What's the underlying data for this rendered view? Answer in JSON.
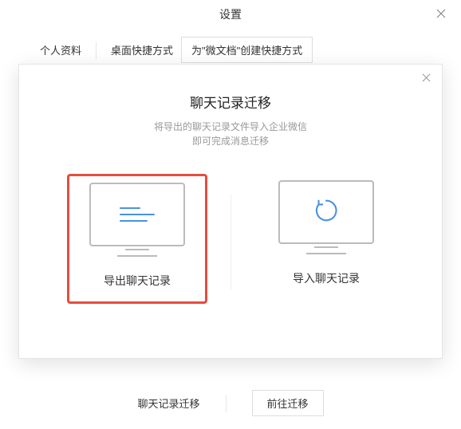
{
  "window": {
    "title": "设置"
  },
  "tabs": {
    "profile": "个人资料",
    "desktopShortcut": "桌面快捷方式",
    "createWeidocShortcut": "为\"微文档\"创建快捷方式"
  },
  "dialog": {
    "title": "聊天记录迁移",
    "subtitle_line1": "将导出的聊天记录文件导入企业微信",
    "subtitle_line2": "即可完成消息迁移",
    "export_label": "导出聊天记录",
    "import_label": "导入聊天记录"
  },
  "bottom": {
    "label": "聊天记录迁移",
    "button": "前往迁移"
  }
}
